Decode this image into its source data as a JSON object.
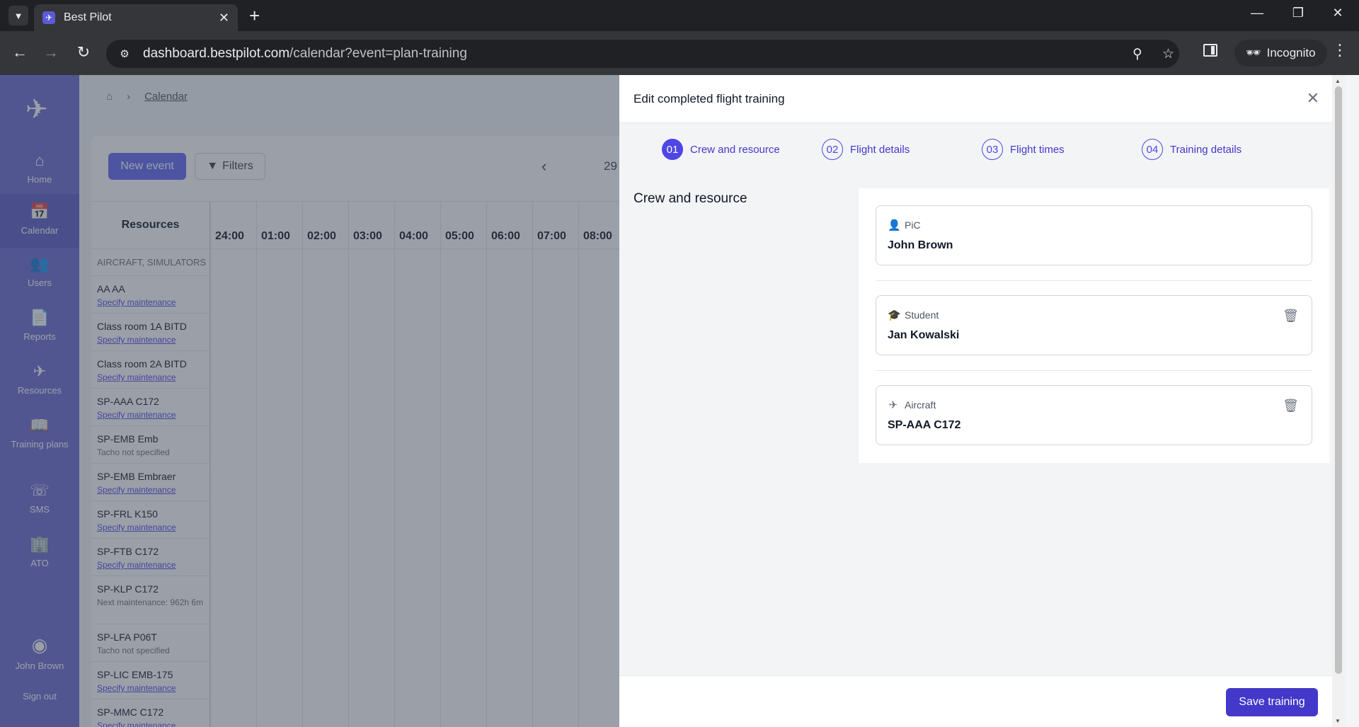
{
  "browser": {
    "tab_title": "Best Pilot",
    "url_domain": "dashboard.bestpilot.com",
    "url_path": "/calendar?event=plan-training",
    "incognito_label": "Incognito"
  },
  "sidebar": {
    "items": [
      {
        "label": "Home",
        "icon": "home-icon"
      },
      {
        "label": "Calendar",
        "icon": "calendar-icon"
      },
      {
        "label": "Users",
        "icon": "users-icon"
      },
      {
        "label": "Reports",
        "icon": "document-icon"
      },
      {
        "label": "Resources",
        "icon": "plane-icon"
      },
      {
        "label": "Training plans",
        "icon": "book-icon"
      },
      {
        "label": "SMS",
        "icon": "phone-icon"
      },
      {
        "label": "ATO",
        "icon": "building-icon"
      }
    ],
    "user_name": "John Brown",
    "sign_out": "Sign out"
  },
  "calendar": {
    "breadcrumb": "Calendar",
    "new_event": "New event",
    "filters": "Filters",
    "date_fragment": "29",
    "resources_header": "Resources",
    "hours": [
      "24:00",
      "01:00",
      "02:00",
      "03:00",
      "04:00",
      "05:00",
      "06:00",
      "07:00",
      "08:00"
    ],
    "group_label": "AIRCRAFT, SIMULATORS",
    "rows": [
      {
        "name": "AA AA",
        "sub": "Specify maintenance",
        "link": true
      },
      {
        "name": "Class room 1A BITD",
        "sub": "Specify maintenance",
        "link": true
      },
      {
        "name": "Class room 2A BITD",
        "sub": "Specify maintenance",
        "link": true
      },
      {
        "name": "SP-AAA C172",
        "sub": "Specify maintenance",
        "link": true
      },
      {
        "name": "SP-EMB Emb",
        "sub": "Tacho not specified",
        "link": false
      },
      {
        "name": "SP-EMB Embraer",
        "sub": "Specify maintenance",
        "link": true
      },
      {
        "name": "SP-FRL K150",
        "sub": "Specify maintenance",
        "link": true
      },
      {
        "name": "SP-FTB C172",
        "sub": "Specify maintenance",
        "link": true
      },
      {
        "name": "SP-KLP C172",
        "sub": "Next maintenance: 962h 6m",
        "link": false
      },
      {
        "name": "SP-LFA P06T",
        "sub": "Tacho not specified",
        "link": false
      },
      {
        "name": "SP-LIC EMB-175",
        "sub": "Specify maintenance",
        "link": true
      },
      {
        "name": "SP-MMC C172",
        "sub": "Specify maintenance",
        "link": true
      }
    ]
  },
  "drawer": {
    "title": "Edit completed flight training",
    "steps": [
      {
        "num": "01",
        "label": "Crew and resource"
      },
      {
        "num": "02",
        "label": "Flight details"
      },
      {
        "num": "03",
        "label": "Flight times"
      },
      {
        "num": "04",
        "label": "Training details"
      }
    ],
    "section_title": "Crew and resource",
    "fields": [
      {
        "label": "PiC",
        "value": "John Brown",
        "icon": "person-icon"
      },
      {
        "label": "Student",
        "value": "Jan Kowalski",
        "icon": "graduation-cap-icon"
      },
      {
        "label": "Aircraft",
        "value": "SP-AAA C172",
        "icon": "plane-icon"
      }
    ],
    "save_label": "Save training"
  }
}
